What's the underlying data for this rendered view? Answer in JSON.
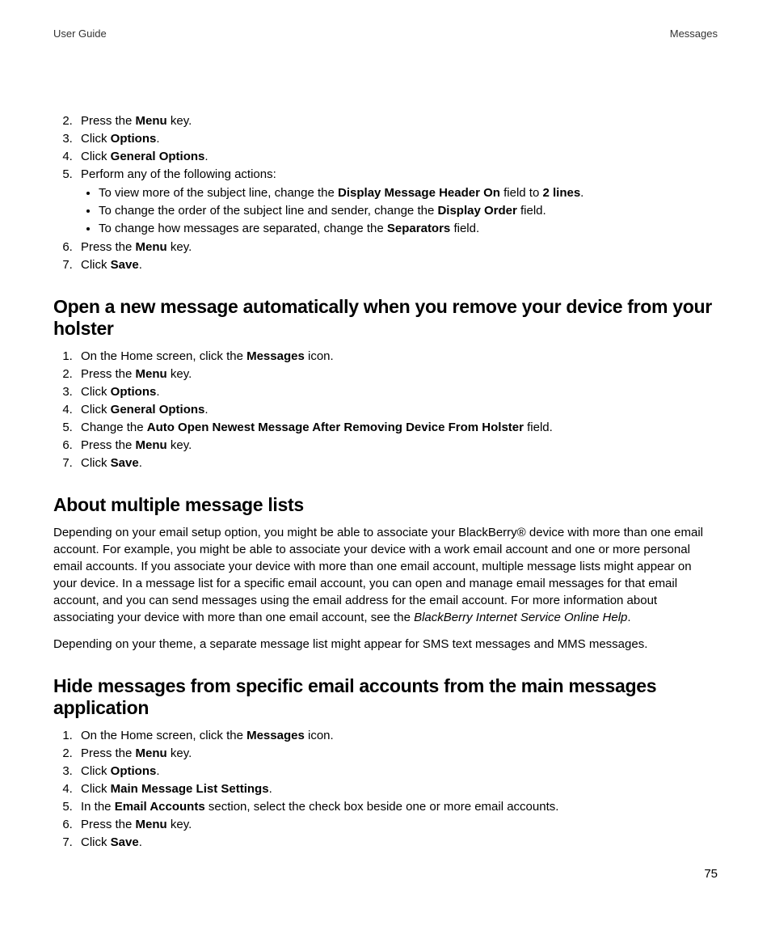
{
  "header": {
    "left": "User Guide",
    "right": "Messages"
  },
  "page_number": "75",
  "block1": {
    "start": 2,
    "items": [
      {
        "pre": "Press the ",
        "b": "Menu",
        "post": " key."
      },
      {
        "pre": "Click ",
        "b": "Options",
        "post": "."
      },
      {
        "pre": "Click ",
        "b": "General Options",
        "post": "."
      },
      {
        "pre": "Perform any of the following actions:",
        "bullets": [
          {
            "pre": "To view more of the subject line, change the ",
            "b1": "Display Message Header On",
            "mid": " field to ",
            "b2": "2 lines",
            "post": "."
          },
          {
            "pre": "To change the order of the subject line and sender, change the ",
            "b1": "Display Order",
            "post": " field."
          },
          {
            "pre": "To change how messages are separated, change the ",
            "b1": "Separators",
            "post": " field."
          }
        ]
      },
      {
        "pre": "Press the ",
        "b": "Menu",
        "post": " key."
      },
      {
        "pre": "Click ",
        "b": "Save",
        "post": "."
      }
    ]
  },
  "section2": {
    "heading": "Open a new message automatically when you remove your device from your holster",
    "start": 1,
    "items": [
      {
        "pre": "On the Home screen, click the ",
        "b": "Messages",
        "post": " icon."
      },
      {
        "pre": "Press the ",
        "b": "Menu",
        "post": " key."
      },
      {
        "pre": "Click ",
        "b": "Options",
        "post": "."
      },
      {
        "pre": "Click ",
        "b": "General Options",
        "post": "."
      },
      {
        "pre": "Change the ",
        "b": "Auto Open Newest Message After Removing Device From Holster",
        "post": " field."
      },
      {
        "pre": "Press the ",
        "b": "Menu",
        "post": " key."
      },
      {
        "pre": "Click ",
        "b": "Save",
        "post": "."
      }
    ]
  },
  "section3": {
    "heading": "About multiple message lists",
    "p1_a": "Depending on your email setup option, you might be able to associate your BlackBerry® device with more than one email account. For example, you might be able to associate your device with a work email account and one or more personal email accounts. If you associate your device with more than one email account, multiple message lists might appear on your device. In a message list for a specific email account, you can open and manage email messages for that email account, and you can send messages using the email address for the email account. For more information about associating your device with more than one email account, see the ",
    "p1_i": "BlackBerry Internet Service Online Help",
    "p1_b": ".",
    "p2": "Depending on your theme, a separate message list might appear for SMS text messages and MMS messages."
  },
  "section4": {
    "heading": "Hide messages from specific email accounts from the main messages application",
    "start": 1,
    "items": [
      {
        "pre": "On the Home screen, click the ",
        "b": "Messages",
        "post": " icon."
      },
      {
        "pre": "Press the ",
        "b": "Menu",
        "post": " key."
      },
      {
        "pre": "Click ",
        "b": "Options",
        "post": "."
      },
      {
        "pre": "Click ",
        "b": "Main Message List Settings",
        "post": "."
      },
      {
        "pre": "In the ",
        "b": "Email Accounts",
        "post": " section, select the check box beside one or more email accounts."
      },
      {
        "pre": "Press the ",
        "b": "Menu",
        "post": " key."
      },
      {
        "pre": "Click ",
        "b": "Save",
        "post": "."
      }
    ]
  }
}
